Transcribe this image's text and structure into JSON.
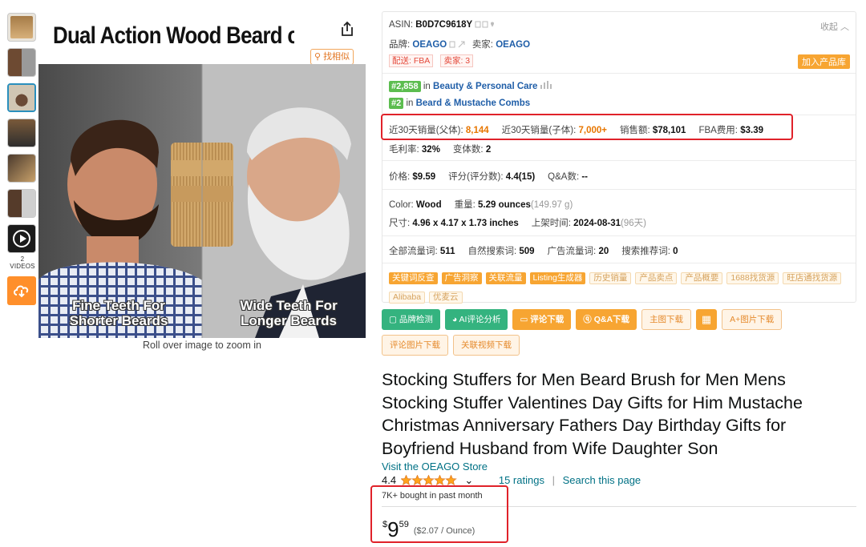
{
  "gallery": {
    "videos_label": "2 VIDEOS",
    "roll_over_text": "Roll over image to zoom in",
    "find_similar": "找相似",
    "image_title": "Dual Action Wood Beard comb",
    "caption_left": "Fine Teeth For Shorter Beards",
    "caption_right": "Wide Teeth For Longer Beards"
  },
  "panel": {
    "asin_label": "ASIN:",
    "asin_value": "B0D7C9618Y",
    "collapse": "收起",
    "brand_label": "品牌:",
    "brand_value": "OEAGO",
    "seller_label": "卖家:",
    "seller_value": "OEAGO",
    "delivery_tag": "配送: FBA",
    "seller_tag": "卖家: 3",
    "add_to_library": "加入产品库",
    "rank1_badge": "#2,858",
    "rank1_in": "in",
    "rank1_category": "Beauty & Personal Care",
    "rank2_badge": "#2",
    "rank2_in": "in",
    "rank2_category": "Beard & Mustache Combs",
    "sales_parent_label": "近30天销量(父体):",
    "sales_parent_value": "8,144",
    "sales_child_label": "近30天销量(子体):",
    "sales_child_value": "7,000+",
    "revenue_label": "销售额:",
    "revenue_value": "$78,101",
    "fba_label": "FBA费用:",
    "fba_value": "$3.39",
    "margin_label": "毛利率:",
    "margin_value": "32%",
    "variants_label": "变体数:",
    "variants_value": "2",
    "price_label": "价格:",
    "price_value": "$9.59",
    "rating_label": "评分(评分数):",
    "rating_value": "4.4(15)",
    "qa_label": "Q&A数:",
    "qa_value": "--",
    "color_label": "Color:",
    "color_value": "Wood",
    "weight_label": "重量:",
    "weight_value": "5.29 ounces",
    "weight_grams": "(149.97 g)",
    "size_label": "尺寸:",
    "size_value": "4.96 x 4.17 x 1.73 inches",
    "listed_label": "上架时间:",
    "listed_value": "2024-08-31",
    "listed_days": "(96天)",
    "traffic_total_label": "全部流量词:",
    "traffic_total_value": "511",
    "organic_label": "自然搜索词:",
    "organic_value": "509",
    "ads_label": "广告流量词:",
    "ads_value": "20",
    "recommend_label": "搜索推荐词:",
    "recommend_value": "0",
    "tags_solid": [
      "关键词反查",
      "广告洞察",
      "关联流量",
      "Listing生成器"
    ],
    "tags_outline": [
      "历史销量",
      "产品卖点",
      "产品概要",
      "1688找货源",
      "旺店通找货源"
    ],
    "tags_outline2": [
      "Alibaba",
      "优麦云"
    ]
  },
  "tools": {
    "brand_check": "品牌检测",
    "ai_review": "AI评论分析",
    "review_download": "评论下载",
    "qa_download": "Q&A下载",
    "main_image_download": "主图下载",
    "aplus_download": "A+图片下载",
    "review_image_download": "评论图片下载",
    "related_video_download": "关联视频下载"
  },
  "product": {
    "title": "Stocking Stuffers for Men Beard Brush for Men Mens Stocking Stuffer Valentines Day Gifts for Him Mustache Christmas Anniversary Fathers Day Birthday Gifts for Boyfriend Husband from Wife Daughter Son",
    "store_link": "Visit the OEAGO Store",
    "rating": "4.4",
    "rating_fraction": 0.88,
    "ratings_count": "15 ratings",
    "separator": "|",
    "search_page": "Search this page",
    "bought": "7K+ bought in past month",
    "price_symbol": "$",
    "price_whole": "9",
    "price_fraction": "59",
    "price_per_unit": "($2.07 / Ounce)"
  },
  "colors": {
    "highlight": "#e0222a",
    "accent_orange": "#f7a532",
    "accent_green": "#34b37f",
    "link_blue": "#1f5ea8",
    "amazon_link": "#007185",
    "star": "#ffa41c"
  }
}
